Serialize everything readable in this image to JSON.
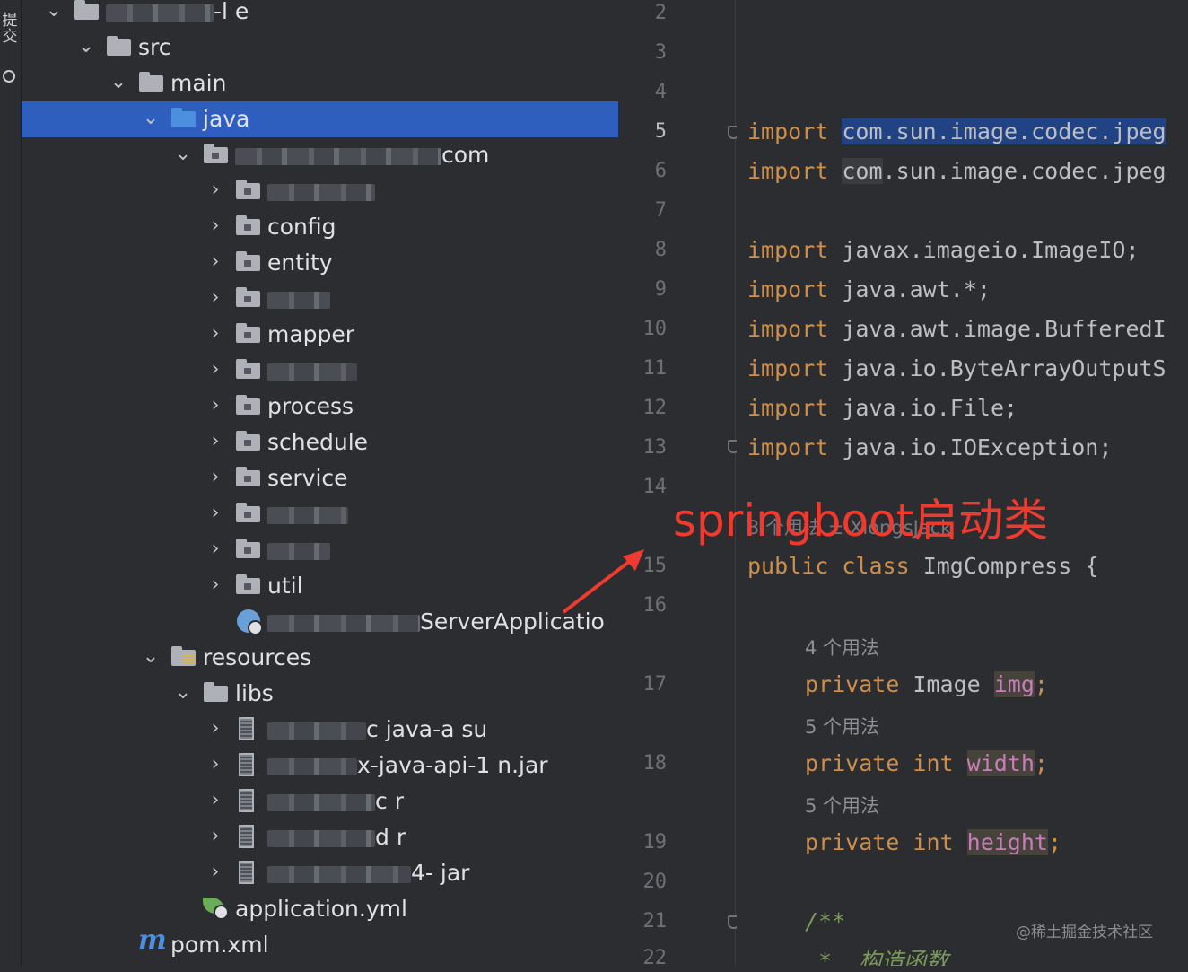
{
  "tool_strip": {
    "label": "提交"
  },
  "tree": {
    "rows": [
      {
        "name": "tree-row-project",
        "label": "-l         e",
        "icon": "folder-icon",
        "chev": "⌄",
        "blurred": true
      },
      {
        "name": "tree-row-src",
        "label": "src",
        "icon": "folder-icon",
        "chev": "⌄"
      },
      {
        "name": "tree-row-main",
        "label": "main",
        "icon": "folder-icon",
        "chev": "⌄"
      },
      {
        "name": "tree-row-java",
        "label": "java",
        "icon": "source-folder-icon",
        "chev": "⌄",
        "selected": true
      },
      {
        "name": "tree-row-com",
        "label": "com",
        "icon": "package-icon",
        "chev": "⌄",
        "blurred": true
      },
      {
        "name": "tree-row-pkg-hidden-1",
        "label": "",
        "icon": "package-icon",
        "chev": "›",
        "blurred": true
      },
      {
        "name": "tree-row-config",
        "label": "config",
        "icon": "package-icon",
        "chev": "›"
      },
      {
        "name": "tree-row-entity",
        "label": "entity",
        "icon": "package-icon",
        "chev": "›"
      },
      {
        "name": "tree-row-pkg-hidden-2",
        "label": "",
        "icon": "package-icon",
        "chev": "›",
        "blurred": true
      },
      {
        "name": "tree-row-mapper",
        "label": "mapper",
        "icon": "package-icon",
        "chev": "›"
      },
      {
        "name": "tree-row-pkg-hidden-3",
        "label": "",
        "icon": "package-icon",
        "chev": "›",
        "blurred": true
      },
      {
        "name": "tree-row-process",
        "label": "process",
        "icon": "package-icon",
        "chev": "›"
      },
      {
        "name": "tree-row-schedule",
        "label": "schedule",
        "icon": "package-icon",
        "chev": "›"
      },
      {
        "name": "tree-row-service",
        "label": "service",
        "icon": "package-icon",
        "chev": "›"
      },
      {
        "name": "tree-row-pkg-hidden-4",
        "label": "",
        "icon": "package-icon",
        "chev": "›",
        "blurred": true
      },
      {
        "name": "tree-row-pkg-hidden-5",
        "label": "",
        "icon": "package-icon",
        "chev": "›",
        "blurred": true
      },
      {
        "name": "tree-row-util",
        "label": "util",
        "icon": "package-icon",
        "chev": "›"
      },
      {
        "name": "tree-row-server-application",
        "label": "ServerApplicatio",
        "icon": "spring-boot-class-icon",
        "chev": "",
        "blurred": true
      },
      {
        "name": "tree-row-resources",
        "label": "resources",
        "icon": "resources-folder-icon",
        "chev": "⌄"
      },
      {
        "name": "tree-row-libs",
        "label": "libs",
        "icon": "folder-icon",
        "chev": "⌄"
      },
      {
        "name": "tree-row-jar-1",
        "label": "c      java-a      su",
        "icon": "jar-icon",
        "chev": "›",
        "blurred": true
      },
      {
        "name": "tree-row-jar-2",
        "label": "x-java-api-1   n.jar",
        "icon": "jar-icon",
        "chev": "›",
        "blurred": true
      },
      {
        "name": "tree-row-jar-3",
        "label": "c     r",
        "icon": "jar-icon",
        "chev": "›",
        "blurred": true
      },
      {
        "name": "tree-row-jar-4",
        "label": "d     r",
        "icon": "jar-icon",
        "chev": "›",
        "blurred": true
      },
      {
        "name": "tree-row-jar-5",
        "label": "4-  jar",
        "icon": "jar-icon",
        "chev": "›",
        "blurred": true
      },
      {
        "name": "tree-row-application-yml",
        "label": "application.yml",
        "icon": "spring-yml-icon",
        "chev": ""
      },
      {
        "name": "tree-row-pom-xml",
        "label": "pom.xml",
        "icon": "maven-icon",
        "chev": ""
      }
    ]
  },
  "gutter": {
    "line_numbers": [
      "2",
      "3",
      "4",
      "5",
      "6",
      "7",
      "8",
      "9",
      "10",
      "11",
      "12",
      "13",
      "14",
      "15",
      "16",
      "17",
      "18",
      "19",
      "20",
      "21",
      "22"
    ],
    "current_line": "5"
  },
  "editor": {
    "imports": [
      {
        "kw": "import",
        "pkg": "com",
        "rest": ".sun.image.codec.jpeg"
      },
      {
        "kw": "import",
        "pkg": "com",
        "rest": ".sun.image.codec.jpeg"
      },
      {
        "kw": "import",
        "text": "javax.imageio.ImageIO;"
      },
      {
        "kw": "import",
        "text": "java.awt.*;"
      },
      {
        "kw": "import",
        "text": "java.awt.image.BufferedI"
      },
      {
        "kw": "import",
        "text": "java.io.ByteArrayOutputS"
      },
      {
        "kw": "import",
        "text": "java.io.File;"
      },
      {
        "kw": "import",
        "text": "java.io.IOException;"
      }
    ],
    "usage_hint_class": "3 个用法  ± XiongsJack",
    "class_decl": {
      "kw1": "public",
      "kw2": "class",
      "name": "ImgCompress {"
    },
    "fields": [
      {
        "hint": "4 个用法",
        "kw": "private",
        "type": "Image",
        "name": "img"
      },
      {
        "hint": "5 个用法",
        "kw": "private int",
        "type": "",
        "name": "width"
      },
      {
        "hint": "5 个用法",
        "kw": "private int",
        "type": "",
        "name": "height"
      }
    ],
    "comment_open": "/**",
    "comment_line": " *  构造函数"
  },
  "annotation": {
    "text": "springboot启动类",
    "color": "#ef3a2f"
  },
  "watermark": "@稀土掘金技术社区"
}
